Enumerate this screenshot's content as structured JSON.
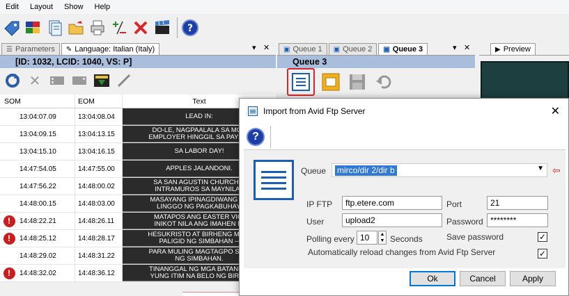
{
  "menu": [
    "Edit",
    "Layout",
    "Show",
    "Help"
  ],
  "toolbar_icons": [
    "tag-icon",
    "flags-icon",
    "documents-icon",
    "open-folder-icon",
    "print-icon",
    "add-remove-icon",
    "delete-icon",
    "clapper-icon",
    "help-icon"
  ],
  "left_pane": {
    "tabs": [
      {
        "label": "Parameters",
        "active": false
      },
      {
        "label": "Language: Italian (Italy)",
        "active": true
      }
    ],
    "header": "[ID: 1032, LCID: 1040, VS: P]",
    "columns": [
      "SOM",
      "EOM",
      "Text"
    ],
    "rows": [
      {
        "alert": false,
        "som": "13:04:07.09",
        "eom": "13:04:08.04",
        "text": "LEAD IN:"
      },
      {
        "alert": false,
        "som": "13:04:09.15",
        "eom": "13:04:13.15",
        "text": "DO-LE, NAGPAALALA SA MGA\nEMPLOYER HINGGIL SA PAY RU"
      },
      {
        "alert": false,
        "som": "13:04:15.10",
        "eom": "13:04:16.15",
        "text": "SA LABOR DAY!"
      },
      {
        "alert": false,
        "som": "14:47:54.05",
        "eom": "14:47:55.00",
        "text": "APPLES JALANDONI."
      },
      {
        "alert": false,
        "som": "14:47:56.22",
        "eom": "14:48:00.02",
        "text": "SA SAN AGUSTIN CHURCH S\nINTRAMUROS SA MAYNILA -"
      },
      {
        "alert": false,
        "som": "14:48:00.15",
        "eom": "14:48:03.00",
        "text": "MASAYANG IPINAGDIWANG AN\nLINGGO NG PAGKABUHAY."
      },
      {
        "alert": true,
        "som": "14:48:22.21",
        "eom": "14:48:26.11",
        "text": "MATAPOS ANG EASTER VIGI\nINIKOT NILA ANG IMAHEN NI"
      },
      {
        "alert": true,
        "som": "14:48:25.12",
        "eom": "14:48:28.17",
        "text": "HESUKRISTO AT BIRHENG MARI\nPALIGID NG SIMBAHAN --"
      },
      {
        "alert": false,
        "som": "14:48:29.02",
        "eom": "14:48:31.22",
        "text": "PARA MULING MAGTAGPO SA P\nNG SIMBAHAN."
      },
      {
        "alert": true,
        "som": "14:48:32.02",
        "eom": "14:48:36.12",
        "text": "TINANGGAL NG MGA BATANG A\nYUNG ITIM NA BELO NG BIRHE"
      }
    ]
  },
  "queue_pane": {
    "tabs": [
      {
        "label": "Queue 1",
        "active": false
      },
      {
        "label": "Queue 2",
        "active": false
      },
      {
        "label": "Queue 3",
        "active": true
      }
    ],
    "header": "Queue 3"
  },
  "preview_pane": {
    "tab": "Preview"
  },
  "dialog": {
    "title": "Import from Avid Ftp Server",
    "queue_label": "Queue",
    "queue_value": "mirco/dir 2/dir b",
    "ip_ftp_label": "IP FTP",
    "ip_ftp_value": "ftp.etere.com",
    "port_label": "Port",
    "port_value": "21",
    "user_label": "User",
    "user_value": "upload2",
    "password_label": "Password",
    "password_value": "********",
    "polling_label": "Polling every",
    "polling_value": "10",
    "polling_unit": "Seconds",
    "save_password_label": "Save password",
    "save_password_checked": true,
    "autoreload_label": "Automatically reload changes from Avid Ftp Server",
    "autoreload_checked": true,
    "ok_label": "Ok",
    "cancel_label": "Cancel",
    "apply_label": "Apply"
  },
  "colors": {
    "pane_header": "#a9bedd",
    "highlight": "#d9252a",
    "accent": "#1a5fb4"
  }
}
